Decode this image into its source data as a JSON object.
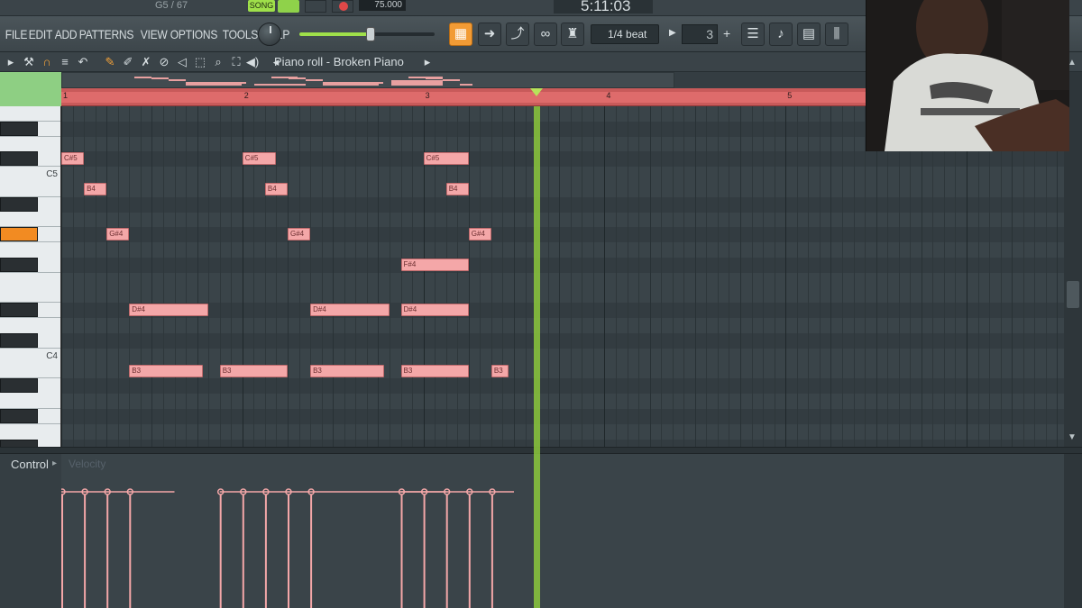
{
  "transport": {
    "hint_text": "G5 / 67",
    "song_mode": "SONG",
    "tempo": "75.000",
    "time_display": "5:11:03"
  },
  "menu": [
    "FILE",
    "EDIT",
    "ADD",
    "PATTERNS",
    "VIEW",
    "OPTIONS",
    "TOOLS",
    "HELP"
  ],
  "snap": {
    "value": "1/4 beat"
  },
  "step": {
    "value": "3"
  },
  "pianoroll": {
    "title": "Piano roll - Broken Piano",
    "bar_numbers": [
      "1",
      "2",
      "3",
      "4",
      "5"
    ],
    "key_labels": {
      "c5": "C5",
      "c4": "C4"
    },
    "active_key_color": "#f28b22",
    "note_color": "#f4a7a8",
    "playhead_color": "#8cc83c",
    "notes": [
      {
        "pitch": "C#5",
        "start": 1.0,
        "length": 0.5
      },
      {
        "pitch": "B4",
        "start": 1.5,
        "length": 0.5
      },
      {
        "pitch": "G#4",
        "start": 2.0,
        "length": 0.5
      },
      {
        "pitch": "D#4",
        "start": 2.5,
        "length": 1.75
      },
      {
        "pitch": "B3",
        "start": 2.5,
        "length": 1.625
      },
      {
        "pitch": "B3",
        "start": 4.5,
        "length": 1.5
      },
      {
        "pitch": "C#5",
        "start": 5.0,
        "length": 0.75
      },
      {
        "pitch": "B4",
        "start": 5.5,
        "length": 0.5
      },
      {
        "pitch": "G#4",
        "start": 6.0,
        "length": 0.5
      },
      {
        "pitch": "D#4",
        "start": 6.5,
        "length": 1.75
      },
      {
        "pitch": "B3",
        "start": 6.5,
        "length": 1.625
      },
      {
        "pitch": "F#4",
        "start": 8.5,
        "length": 1.5
      },
      {
        "pitch": "D#4",
        "start": 8.5,
        "length": 1.5
      },
      {
        "pitch": "B3",
        "start": 8.5,
        "length": 1.5
      },
      {
        "pitch": "C#5",
        "start": 9.0,
        "length": 1.0
      },
      {
        "pitch": "B4",
        "start": 9.5,
        "length": 0.5
      },
      {
        "pitch": "G#4",
        "start": 10.0,
        "length": 0.5
      },
      {
        "pitch": "B3",
        "start": 10.5,
        "length": 0.375
      }
    ]
  },
  "control": {
    "label": "Control",
    "placeholder": "Velocity"
  }
}
